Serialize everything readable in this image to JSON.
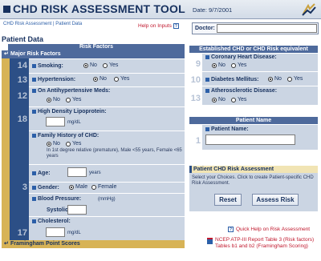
{
  "app": {
    "title": "CHD RISK ASSESSMENT TOOL",
    "date_label": "Date:",
    "date_value": "9/7/2001",
    "nav": "CHD Risk Assessment | Patient Data",
    "help_on_inputs": "Help on Inputs",
    "doctor_label": "Doctor:"
  },
  "patient_data": {
    "section_title": "Patient Data",
    "risk_factors_header": "Risk Factors",
    "major_header": "Major Risk Factors",
    "smoking": {
      "num": "14",
      "label": "Smoking:",
      "no": "No",
      "yes": "Yes",
      "selected": "No"
    },
    "hypertension": {
      "num": "13",
      "label": "Hypertension:",
      "no": "No",
      "yes": "Yes",
      "selected": "No"
    },
    "antihyp": {
      "num": "12",
      "label": "On Antihypertensive Meds:",
      "no": "No",
      "yes": "Yes",
      "selected": "No"
    },
    "hdl": {
      "num": "18",
      "label": "High Density Lipoprotein:",
      "unit": "mg/dL"
    },
    "family": {
      "num": "",
      "label": "Family History of CHD:",
      "no": "No",
      "yes": "Yes",
      "selected": "No",
      "note": "In 1st degree relative (premature), Male <55 years, Female <65 years"
    },
    "age": {
      "num": "",
      "label": "Age:",
      "unit": "years"
    },
    "gender": {
      "num": "3",
      "label": "Gender:",
      "male": "Male",
      "female": "Female",
      "selected": "Male"
    },
    "bp": {
      "num": "",
      "label": "Blood Pressure:",
      "unit": "(mmHg)",
      "systolic": "Systolic"
    },
    "chol": {
      "num": "17",
      "label": "Cholesterol:",
      "unit": "mg/dL"
    },
    "framingham_header": "Framingham Point Scores"
  },
  "established": {
    "header": "Established CHD or CHD Risk equivalent",
    "coronary": {
      "num": "9",
      "label": "Coronary Heart Disease:",
      "no": "No",
      "yes": "Yes",
      "selected": "No"
    },
    "diabetes": {
      "num": "10",
      "label": "Diabetes Mellitus:",
      "no": "No",
      "yes": "Yes",
      "selected": "No"
    },
    "athero": {
      "num": "13",
      "label": "Atherosclerotic Disease:",
      "no": "No",
      "yes": "Yes",
      "selected": "No"
    }
  },
  "patient_name": {
    "header": "Patient Name",
    "num": "1",
    "label": "Patient Name:"
  },
  "assessment": {
    "header": "Patient CHD Risk Assessment",
    "text": "Select your Choices. Click to create Patient-specific CHD Risk Assessment.",
    "reset": "Reset",
    "assess": "Assess Risk"
  },
  "links": {
    "quick_help": "Quick Help on Risk Assessment",
    "ncep": "NCEP ATP-III Report Table 3 (Risk factors) Tables b1 and b2 (Framingham Scoring)"
  }
}
